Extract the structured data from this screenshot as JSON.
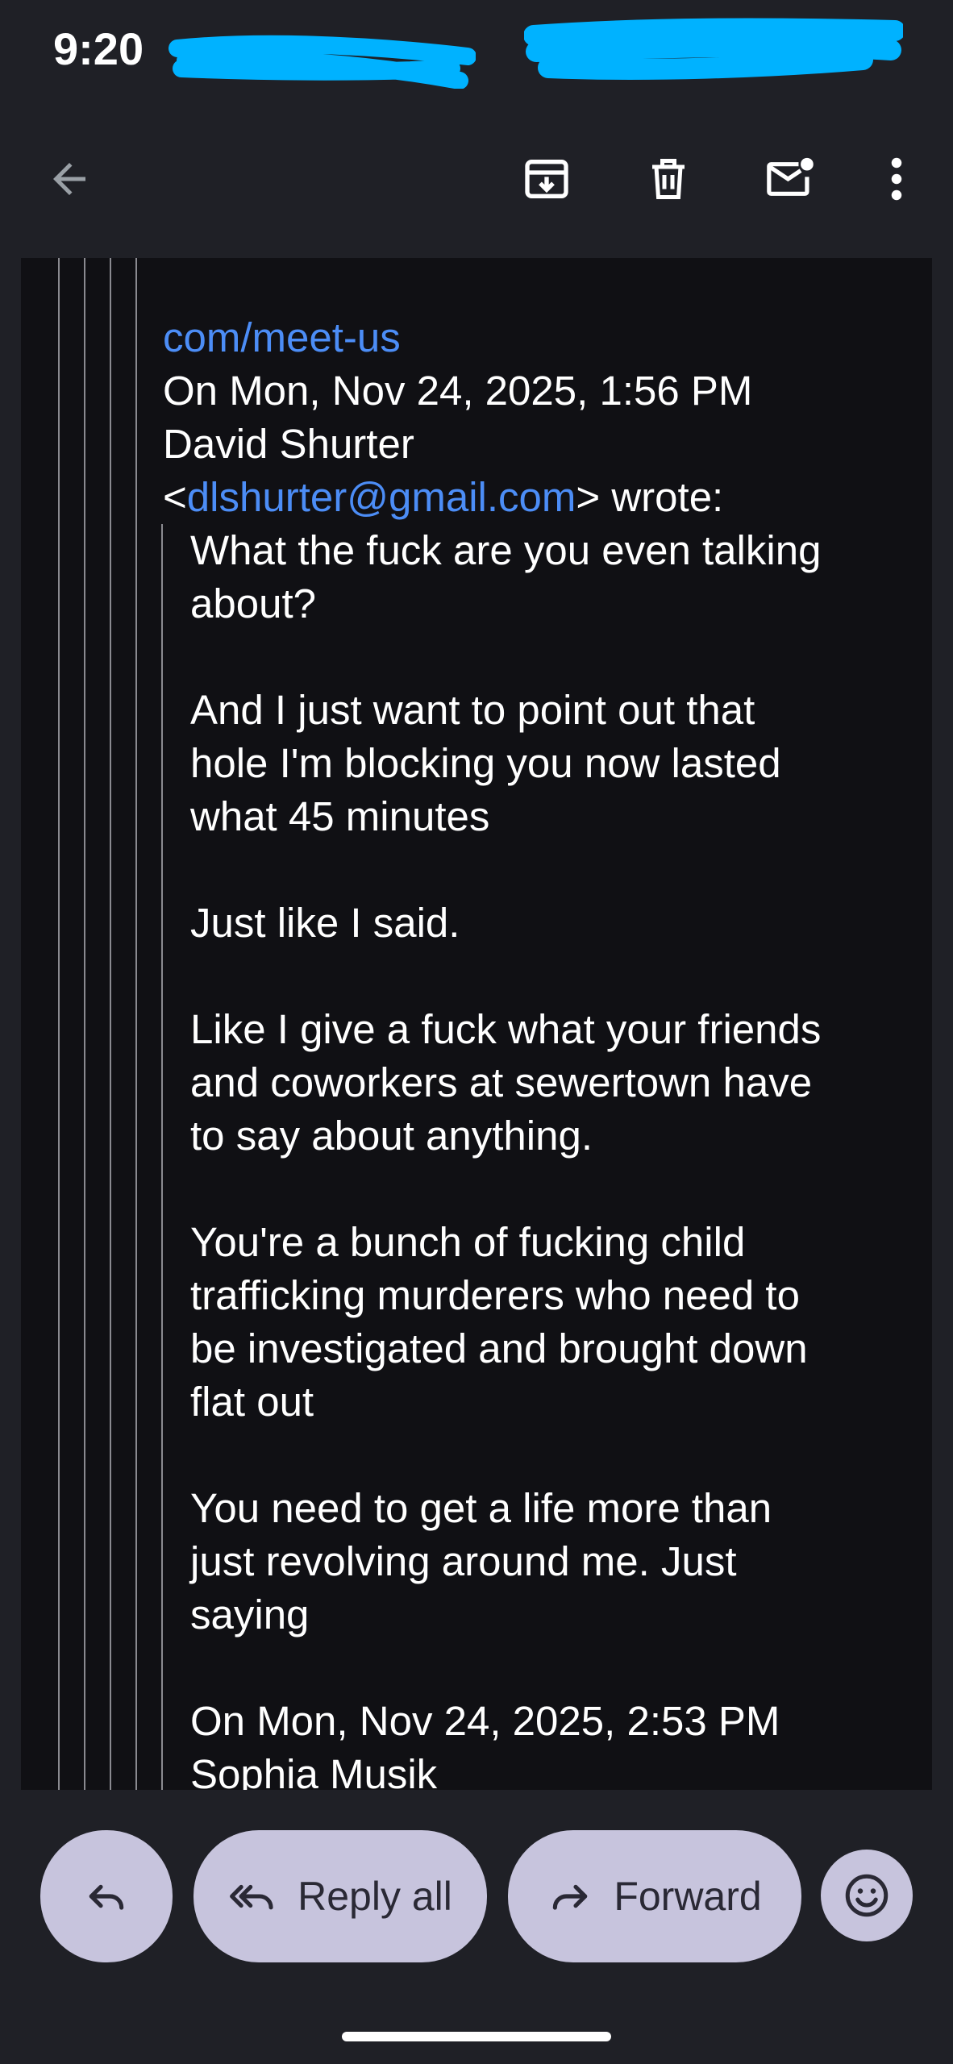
{
  "status_bar": {
    "time": "9:20"
  },
  "toolbar": {
    "back_icon": "arrow-back-icon",
    "archive_icon": "archive-icon",
    "delete_icon": "trash-icon",
    "mark_unread_icon": "mark-unread-icon",
    "more_icon": "more-vert-icon"
  },
  "email": {
    "link_fragment": "com/meet-us",
    "quote_header_line1": "On Mon, Nov 24, 2025, 1:56 PM",
    "quote_header_line2": "David Shurter",
    "quote_header_open": "<",
    "quote_header_email": "dlshurter@gmail.com",
    "quote_header_close": "> wrote:",
    "paragraphs": [
      "What the fuck are you even talking\nabout?",
      "And I just want to point out that\nhole I'm blocking you now lasted\nwhat 45 minutes",
      "Just like I said.",
      "Like I give a fuck what your friends\nand coworkers at sewertown have\nto say about anything.",
      "You're a bunch of fucking child\ntrafficking murderers who need to\nbe investigated and brought down\nflat out",
      "You need to get a life more than\njust revolving around me. Just\nsaying"
    ],
    "next_quote_line1": "On Mon, Nov 24, 2025, 2:53 PM",
    "next_quote_line2": "Sophia Musik"
  },
  "actions": {
    "reply_icon": "reply-icon",
    "reply_all_label": "Reply all",
    "forward_label": "Forward",
    "emoji_icon": "emoji-icon"
  },
  "colors": {
    "background": "#1f2026",
    "body_background": "#101014",
    "link": "#4c8df6",
    "pill": "#c7c4dd",
    "redaction": "#00b2ff"
  }
}
